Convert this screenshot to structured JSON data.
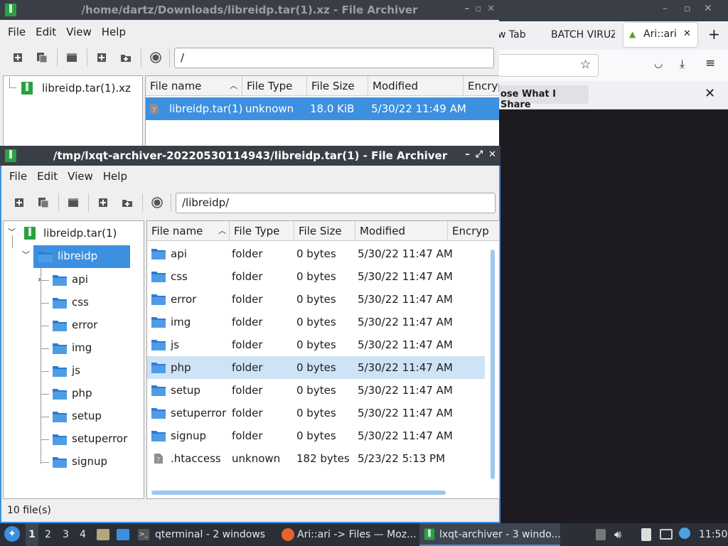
{
  "back_window": {
    "title": "/home/dartz/Downloads/libreidp.tar(1).xz - File Archiver",
    "menu": [
      "File",
      "Edit",
      "View",
      "Help"
    ],
    "path": "/",
    "tree": [
      {
        "label": "libreidp.tar(1).xz"
      }
    ],
    "columns": [
      "File name",
      "File Type",
      "File Size",
      "Modified",
      "Encryp"
    ],
    "rows": [
      {
        "name": "libreidp.tar(1)",
        "type": "unknown",
        "size": "18.0 KiB",
        "modified": "5/30/22 11:49 AM"
      }
    ]
  },
  "browser": {
    "tabs": [
      {
        "label": "w Tab"
      },
      {
        "label": "BATCH VIRUZ"
      },
      {
        "label": "Ari::ari"
      }
    ],
    "notification": "ose What I Share"
  },
  "front_window": {
    "title": "/tmp/lxqt-archiver-20220530114943/libreidp.tar(1) - File Archiver",
    "menu": [
      "File",
      "Edit",
      "View",
      "Help"
    ],
    "path": "/libreidp/",
    "tree_root": "libreidp.tar(1)",
    "tree_folder": "libreidp",
    "tree_children": [
      "api",
      "css",
      "error",
      "img",
      "js",
      "php",
      "setup",
      "setuperror",
      "signup"
    ],
    "columns": [
      "File name",
      "File Type",
      "File Size",
      "Modified",
      "Encryp"
    ],
    "rows": [
      {
        "name": "api",
        "type": "folder",
        "size": "0 bytes",
        "modified": "5/30/22 11:47 AM"
      },
      {
        "name": "css",
        "type": "folder",
        "size": "0 bytes",
        "modified": "5/30/22 11:47 AM"
      },
      {
        "name": "error",
        "type": "folder",
        "size": "0 bytes",
        "modified": "5/30/22 11:47 AM"
      },
      {
        "name": "img",
        "type": "folder",
        "size": "0 bytes",
        "modified": "5/30/22 11:47 AM"
      },
      {
        "name": "js",
        "type": "folder",
        "size": "0 bytes",
        "modified": "5/30/22 11:47 AM"
      },
      {
        "name": "php",
        "type": "folder",
        "size": "0 bytes",
        "modified": "5/30/22 11:47 AM"
      },
      {
        "name": "setup",
        "type": "folder",
        "size": "0 bytes",
        "modified": "5/30/22 11:47 AM"
      },
      {
        "name": "setuperror",
        "type": "folder",
        "size": "0 bytes",
        "modified": "5/30/22 11:47 AM"
      },
      {
        "name": "signup",
        "type": "folder",
        "size": "0 bytes",
        "modified": "5/30/22 11:47 AM"
      },
      {
        "name": ".htaccess",
        "type": "unknown",
        "size": "182 bytes",
        "modified": "5/23/22 5:13 PM"
      }
    ],
    "status": "10 file(s)"
  },
  "taskbar": {
    "desktops": [
      "1",
      "2",
      "3",
      "4"
    ],
    "tasks": [
      {
        "label": "qterminal - 2 windows"
      },
      {
        "label": "Ari::ari -> Files — Moz..."
      },
      {
        "label": "lxqt-archiver - 3 windo..."
      }
    ],
    "clock": "11:50"
  },
  "colors": {
    "accent": "#3d8fe0",
    "titlebar": "#3a3f47",
    "selected_row": "#cfe3f7",
    "folder": "#3f8ad8",
    "archive_green": "#2aa042"
  }
}
